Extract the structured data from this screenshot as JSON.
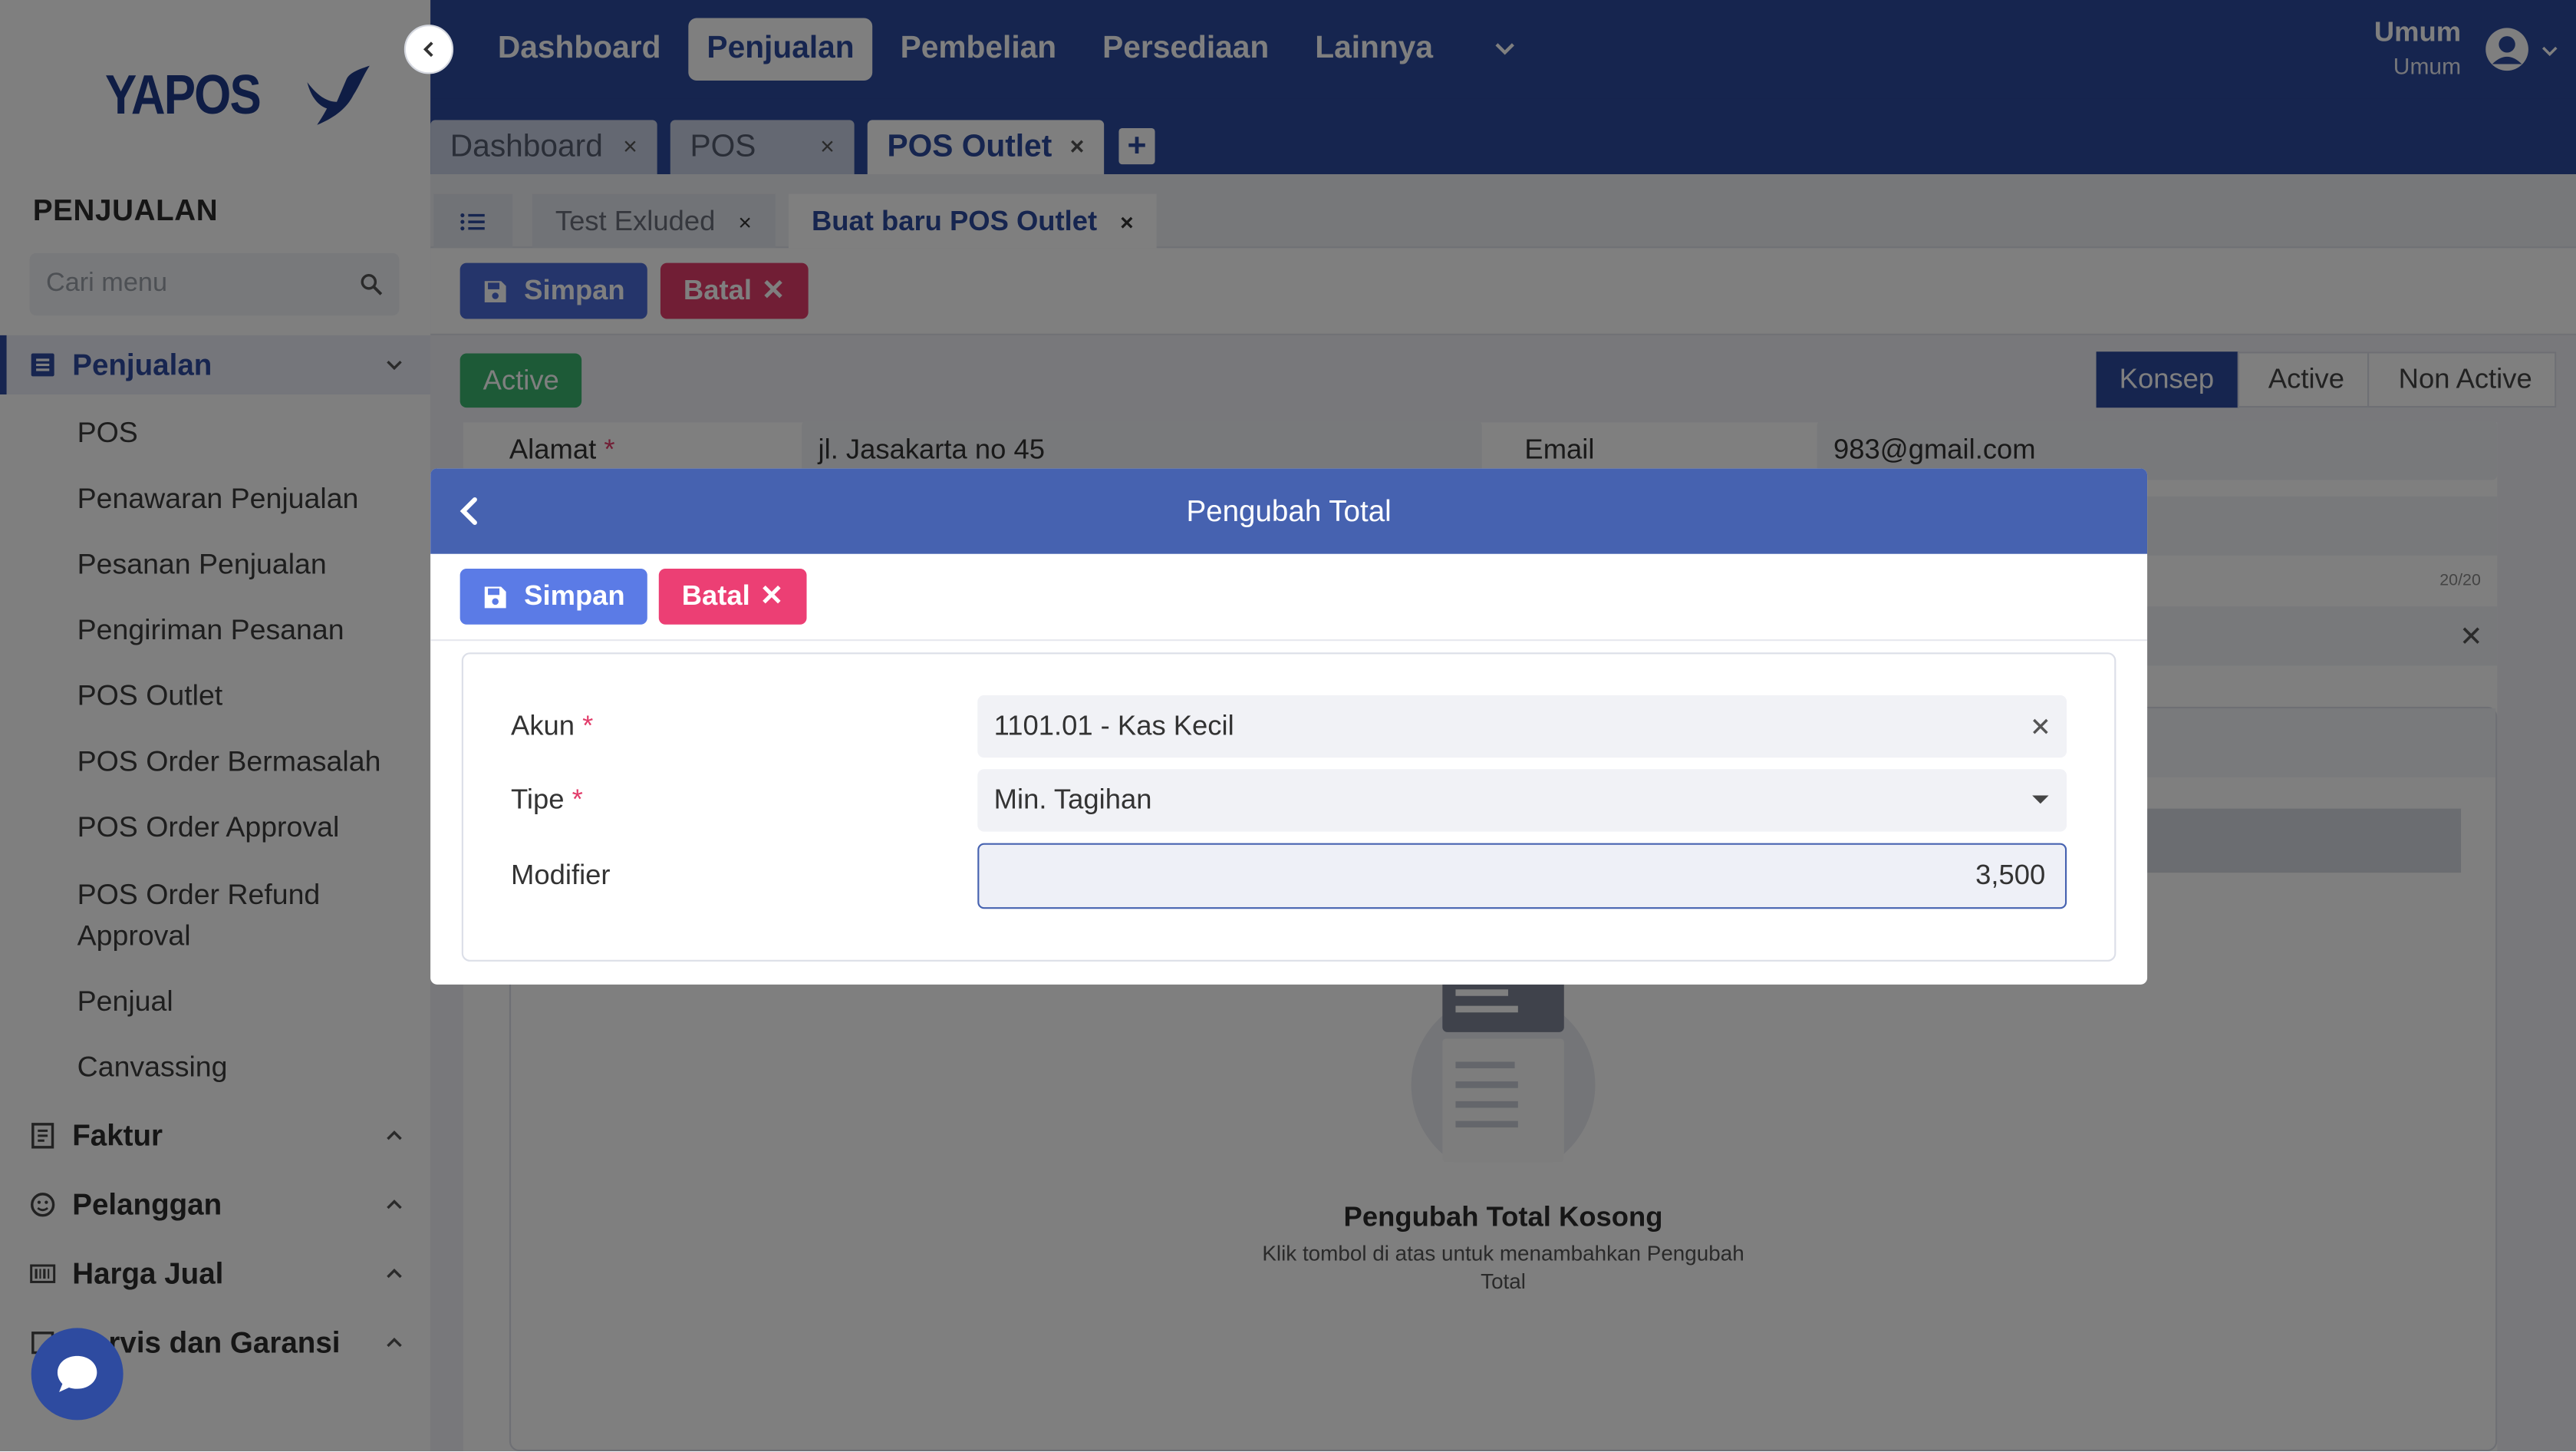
{
  "app": {
    "logo_text": "YAPOS",
    "colors": {
      "primary": "#2d4a9e",
      "accent_blue": "#4a6bd6",
      "danger": "#e23c6a",
      "success": "#3bb56e"
    }
  },
  "topnav": {
    "items": [
      "Dashboard",
      "Penjualan",
      "Pembelian",
      "Persediaan",
      "Lainnya"
    ],
    "selected": "Penjualan",
    "user_name": "Umum",
    "user_role": "Umum"
  },
  "page_tabs": [
    {
      "label": "Dashboard"
    },
    {
      "label": "POS"
    },
    {
      "label": "POS Outlet"
    }
  ],
  "sidebar": {
    "section_title": "PENJUALAN",
    "search_placeholder": "Cari menu",
    "groups": [
      {
        "label": "Penjualan",
        "icon": "list-icon"
      },
      {
        "label": "Faktur",
        "icon": "receipt-icon"
      },
      {
        "label": "Pelanggan",
        "icon": "smile-icon"
      },
      {
        "label": "Harga Jual",
        "icon": "barcode-icon"
      },
      {
        "label": "Servis dan Garansi",
        "icon": "tools-icon"
      }
    ],
    "sub_items": [
      "POS",
      "Penawaran Penjualan",
      "Pesanan Penjualan",
      "Pengiriman Pesanan",
      "POS Outlet",
      "POS Order Bermasalah",
      "POS Order Approval",
      "POS Order Refund Approval",
      "Penjual",
      "Canvassing"
    ]
  },
  "sub_tabs": [
    {
      "label": "Test Exluded"
    },
    {
      "label": "Buat baru POS Outlet"
    }
  ],
  "toolbar": {
    "save_label": "Simpan",
    "cancel_label": "Batal"
  },
  "status": {
    "badge": "Active",
    "steps": [
      "Konsep",
      "Active",
      "Non Active"
    ],
    "current_step": "Konsep"
  },
  "form": {
    "address_label": "Alamat",
    "address_value": "jl. Jasakarta no 45",
    "email_label": "Email",
    "email_value": "983@gmail.com",
    "counter": "20/20"
  },
  "empty_state": {
    "title": "Pengubah Total Kosong",
    "description": "Klik tombol di atas untuk menambahkan Pengubah Total"
  },
  "modal": {
    "title": "Pengubah Total",
    "save_label": "Simpan",
    "cancel_label": "Batal",
    "fields": {
      "akun_label": "Akun",
      "akun_value": "1101.01 - Kas Kecil",
      "tipe_label": "Tipe",
      "tipe_value": "Min. Tagihan",
      "modifier_label": "Modifier",
      "modifier_value": "3,500"
    }
  }
}
